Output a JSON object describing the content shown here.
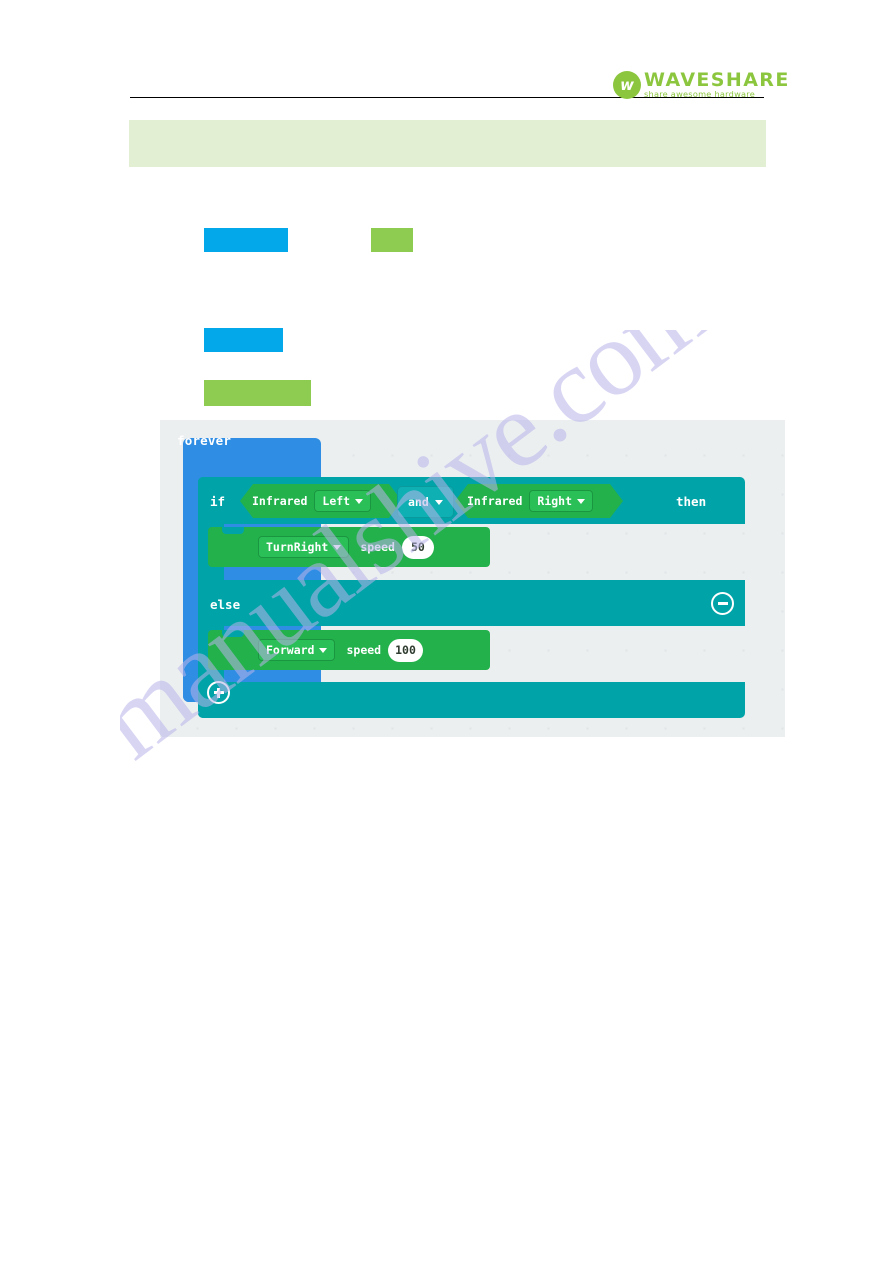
{
  "page": {
    "watermark": "manualshive.com"
  },
  "header": {
    "logo": {
      "mark_glyph": "w",
      "name": "WAVESHARE",
      "tagline": "share awesome hardware"
    }
  },
  "banner": {
    "text": ""
  },
  "redactions": [
    {
      "id": "bar-1",
      "color": "#02a8ea"
    },
    {
      "id": "bar-2",
      "color": "#8dcc51"
    },
    {
      "id": "bar-3",
      "color": "#02a8ea"
    },
    {
      "id": "bar-4",
      "color": "#8dcc51"
    }
  ],
  "editor": {
    "canvas_bg": "#eceff0",
    "blocks": {
      "forever": {
        "label": "forever",
        "color": "#2f8de4"
      },
      "conditional": {
        "color": "#00a4a8",
        "if_label": "if",
        "then_label": "then",
        "else_label": "else",
        "and_label": "and",
        "mutator_minus": "minus-icon",
        "mutator_plus": "plus-icon"
      },
      "conditions": [
        {
          "name": "Infrared",
          "selected": "Left",
          "color": "#23b14c"
        },
        {
          "name": "Infrared",
          "selected": "Right",
          "color": "#23b14c"
        }
      ],
      "commands": [
        {
          "direction": "TurnRight",
          "speed_label": "speed",
          "speed": "50",
          "color": "#23b14c"
        },
        {
          "direction": "Forward",
          "speed_label": "speed",
          "speed": "100",
          "color": "#23b14c"
        }
      ]
    }
  }
}
